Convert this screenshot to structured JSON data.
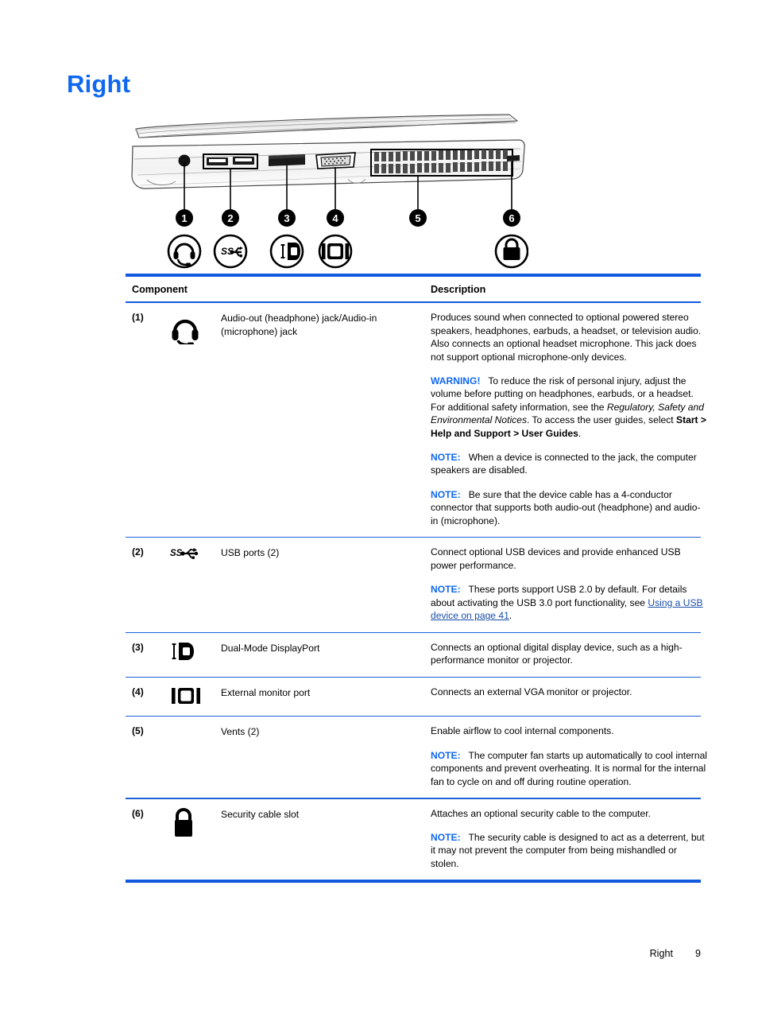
{
  "page": {
    "title": "Right",
    "footer_chapter": "Right",
    "footer_page": "9"
  },
  "colors": {
    "heading_blue": "#1168f0",
    "rule_blue": "#1259e0",
    "note_blue": "#1168f0",
    "link_blue": "#1b4fa8"
  },
  "figure": {
    "alt": "right-side view of laptop showing ports",
    "callouts": [
      "1",
      "2",
      "3",
      "4",
      "5",
      "6"
    ],
    "callout_icons": [
      "headset-icon",
      "superspeed-usb-icon",
      "dual-mode-displayport-icon",
      "external-monitor-icon",
      "",
      "padlock-icon"
    ]
  },
  "table": {
    "headers": {
      "component": "Component",
      "description": "Description"
    },
    "rows": [
      {
        "num": "(1)",
        "icon": "headset-icon",
        "label": "Audio-out (headphone) jack/Audio-in (microphone) jack",
        "desc": [
          {
            "type": "plain",
            "text": "Produces sound when connected to optional powered stereo speakers, headphones, earbuds, a headset, or television audio. Also connects an optional headset microphone. This jack does not support optional microphone-only devices."
          },
          {
            "type": "warning",
            "keyword": "WARNING!",
            "text_1": "To reduce the risk of personal injury, adjust the volume before putting on headphones, earbuds, or a headset. For additional safety information, see the ",
            "italic_1": "Regulatory, Safety and Environmental Notices",
            "text_2": ". To access the user guides, select ",
            "bold_1": "Start > Help and Support > User Guides",
            "text_3": "."
          },
          {
            "type": "note",
            "keyword": "NOTE:",
            "text_1": "When a device is connected to the jack, the computer speakers are disabled."
          },
          {
            "type": "note",
            "keyword": "NOTE:",
            "text_1": "Be sure that the device cable has a 4-conductor connector that supports both audio-out (headphone) and audio-in (microphone)."
          }
        ]
      },
      {
        "num": "(2)",
        "icon": "superspeed-usb-icon",
        "label": "USB ports (2)",
        "desc": [
          {
            "type": "plain",
            "text": "Connect optional USB devices and provide enhanced USB power performance."
          },
          {
            "type": "note-link",
            "keyword": "NOTE:",
            "text_1": "These ports support USB 2.0 by default. For details about activating the USB 3.0 port functionality, see ",
            "link_1": "Using a USB device on page 41",
            "text_2": "."
          }
        ]
      },
      {
        "num": "(3)",
        "icon": "dual-mode-displayport-icon",
        "label": "Dual-Mode DisplayPort",
        "desc": [
          {
            "type": "plain",
            "text": "Connects an optional digital display device, such as a high-performance monitor or projector."
          }
        ]
      },
      {
        "num": "(4)",
        "icon": "external-monitor-icon",
        "label": "External monitor port",
        "desc": [
          {
            "type": "plain",
            "text": "Connects an external VGA monitor or projector."
          }
        ]
      },
      {
        "num": "(5)",
        "icon": "",
        "label": "Vents (2)",
        "desc": [
          {
            "type": "plain",
            "text": "Enable airflow to cool internal components."
          },
          {
            "type": "note",
            "keyword": "NOTE:",
            "text_1": "The computer fan starts up automatically to cool internal components and prevent overheating. It is normal for the internal fan to cycle on and off during routine operation."
          }
        ]
      },
      {
        "num": "(6)",
        "icon": "padlock-icon",
        "label": "Security cable slot",
        "desc": [
          {
            "type": "plain",
            "text": "Attaches an optional security cable to the computer."
          },
          {
            "type": "note",
            "keyword": "NOTE:",
            "text_1": "The security cable is designed to act as a deterrent, but it may not prevent the computer from being mishandled or stolen."
          }
        ]
      }
    ]
  }
}
